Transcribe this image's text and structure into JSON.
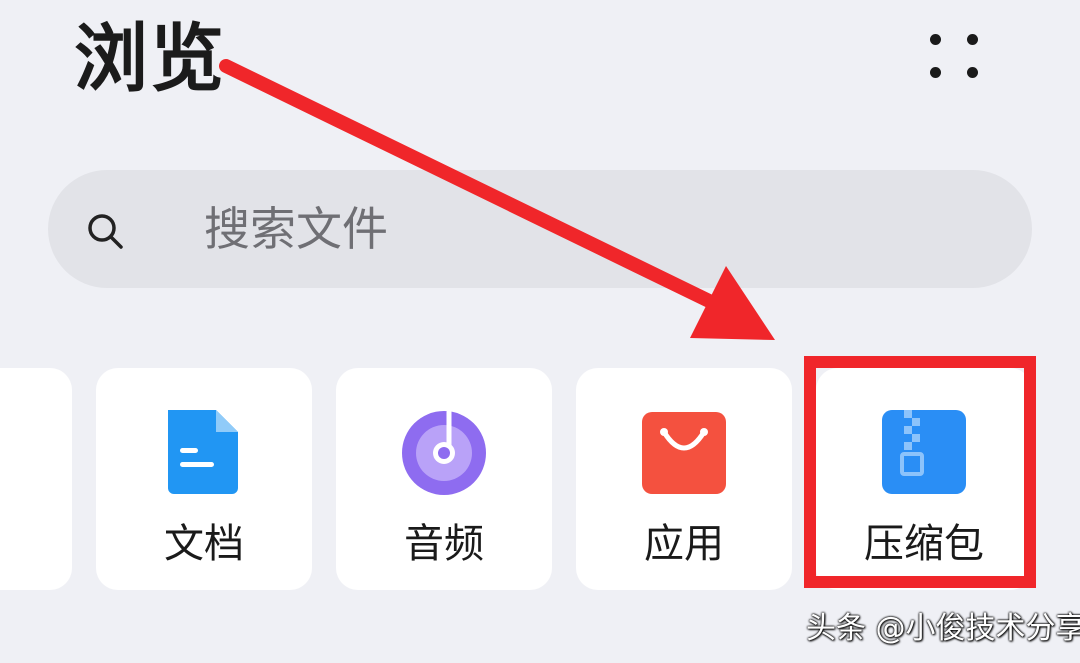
{
  "header": {
    "title": "浏览",
    "more_icon": "more-dots-icon"
  },
  "search": {
    "placeholder": "搜索文件",
    "icon": "search-icon"
  },
  "categories": [
    {
      "label": "文档",
      "icon": "document-icon",
      "color": "#2196f3"
    },
    {
      "label": "音频",
      "icon": "audio-disc-icon",
      "color": "#8e6cf0"
    },
    {
      "label": "应用",
      "icon": "shopping-bag-icon",
      "color": "#f4513f"
    },
    {
      "label": "压缩包",
      "icon": "zip-archive-icon",
      "color": "#2a8ef5"
    }
  ],
  "annotation": {
    "arrow_color": "#f0262a",
    "highlight_color": "#f0262a"
  },
  "watermark": {
    "text": "头条 @小俊技术分享"
  }
}
